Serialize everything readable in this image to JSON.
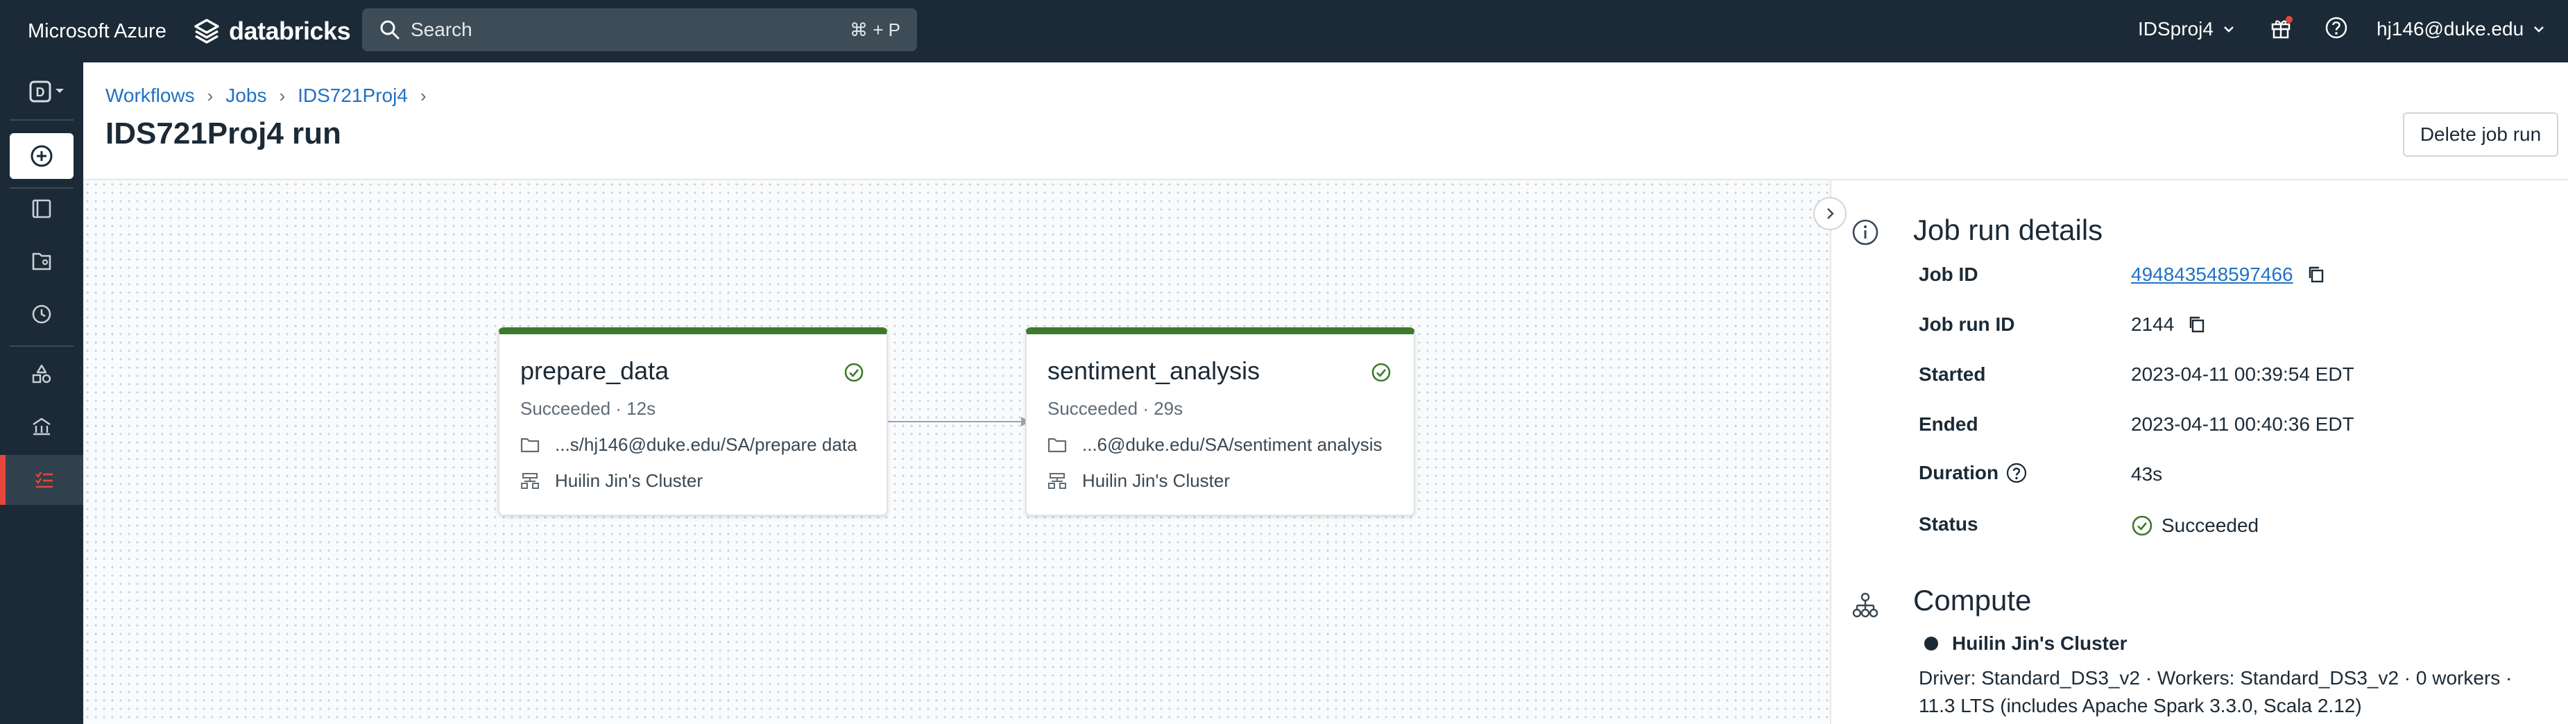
{
  "topbar": {
    "brand": "Microsoft Azure",
    "product": "databricks",
    "search_placeholder": "Search",
    "search_shortcut": "⌘ + P",
    "workspace": "IDSproj4",
    "user": "hj146@duke.edu"
  },
  "rail": {
    "workspace_badge": "D",
    "items": [
      "new",
      "workspace",
      "repos",
      "recents",
      "data",
      "compute",
      "workflows"
    ],
    "selected": "workflows"
  },
  "breadcrumb": [
    "Workflows",
    "Jobs",
    "IDS721Proj4"
  ],
  "page_title": "IDS721Proj4 run",
  "actions": {
    "delete_label": "Delete job run"
  },
  "tasks": [
    {
      "name": "prepare_data",
      "status": "Succeeded · 12s",
      "path": "...s/hj146@duke.edu/SA/prepare data",
      "cluster": "Huilin Jin's Cluster"
    },
    {
      "name": "sentiment_analysis",
      "status": "Succeeded · 29s",
      "path": "...6@duke.edu/SA/sentiment analysis",
      "cluster": "Huilin Jin's Cluster"
    }
  ],
  "details": {
    "title": "Job run details",
    "job_id_label": "Job ID",
    "job_id": "494843548597466",
    "run_id_label": "Job run ID",
    "run_id": "2144",
    "started_label": "Started",
    "started": "2023-04-11 00:39:54 EDT",
    "ended_label": "Ended",
    "ended": "2023-04-11 00:40:36 EDT",
    "duration_label": "Duration",
    "duration": "43s",
    "status_label": "Status",
    "status": "Succeeded"
  },
  "compute": {
    "title": "Compute",
    "cluster_name": "Huilin Jin's Cluster",
    "description": "Driver: Standard_DS3_v2 · Workers: Standard_DS3_v2 · 0 workers · 11.3 LTS (includes Apache Spark 3.3.0, Scala 2.12)"
  },
  "colors": {
    "topbar": "#1b2a36",
    "success": "#3d7a2b",
    "link": "#1f72c4",
    "rail_accent": "#e8453c"
  }
}
